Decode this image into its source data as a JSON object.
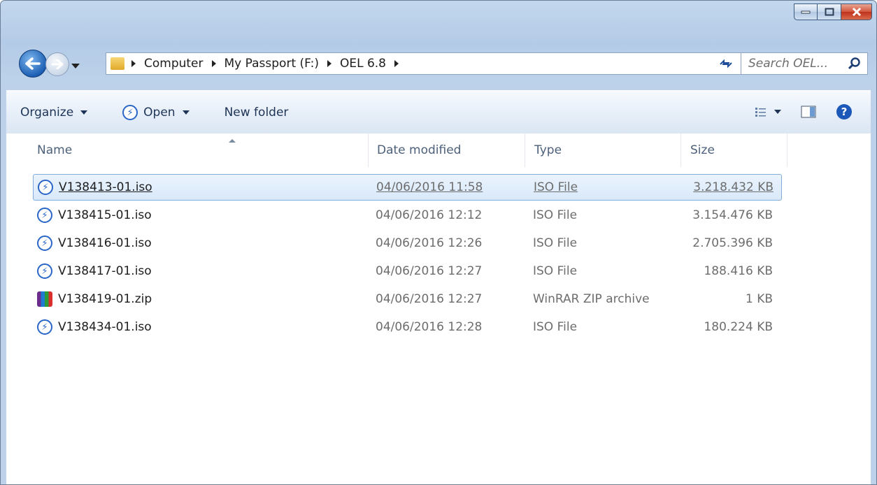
{
  "window": {
    "caption_buttons": {
      "minimize": "minimize-icon",
      "maximize": "maximize-icon",
      "close": "close-icon"
    }
  },
  "nav": {
    "breadcrumbs": [
      "Computer",
      "My Passport (F:)",
      "OEL 6.8"
    ],
    "search_placeholder": "Search OEL..."
  },
  "toolbar": {
    "organize": "Organize",
    "open": "Open",
    "new_folder": "New folder"
  },
  "columns": {
    "name": "Name",
    "date": "Date modified",
    "type": "Type",
    "size": "Size"
  },
  "files": [
    {
      "name": "V138413-01.iso",
      "date": "04/06/2016 11:58",
      "type": "ISO File",
      "size": "3.218.432 KB",
      "icon": "iso-file-icon",
      "selected": true
    },
    {
      "name": "V138415-01.iso",
      "date": "04/06/2016 12:12",
      "type": "ISO File",
      "size": "3.154.476 KB",
      "icon": "iso-file-icon",
      "selected": false
    },
    {
      "name": "V138416-01.iso",
      "date": "04/06/2016 12:26",
      "type": "ISO File",
      "size": "2.705.396 KB",
      "icon": "iso-file-icon",
      "selected": false
    },
    {
      "name": "V138417-01.iso",
      "date": "04/06/2016 12:27",
      "type": "ISO File",
      "size": "188.416 KB",
      "icon": "iso-file-icon",
      "selected": false
    },
    {
      "name": "V138419-01.zip",
      "date": "04/06/2016 12:27",
      "type": "WinRAR ZIP archive",
      "size": "1 KB",
      "icon": "winrar-archive-icon",
      "selected": false
    },
    {
      "name": "V138434-01.iso",
      "date": "04/06/2016 12:28",
      "type": "ISO File",
      "size": "180.224 KB",
      "icon": "iso-file-icon",
      "selected": false
    }
  ],
  "colors": {
    "accent": "#2a66c8",
    "selection": "#d9e9fb",
    "frame": "#bdd2ea"
  }
}
